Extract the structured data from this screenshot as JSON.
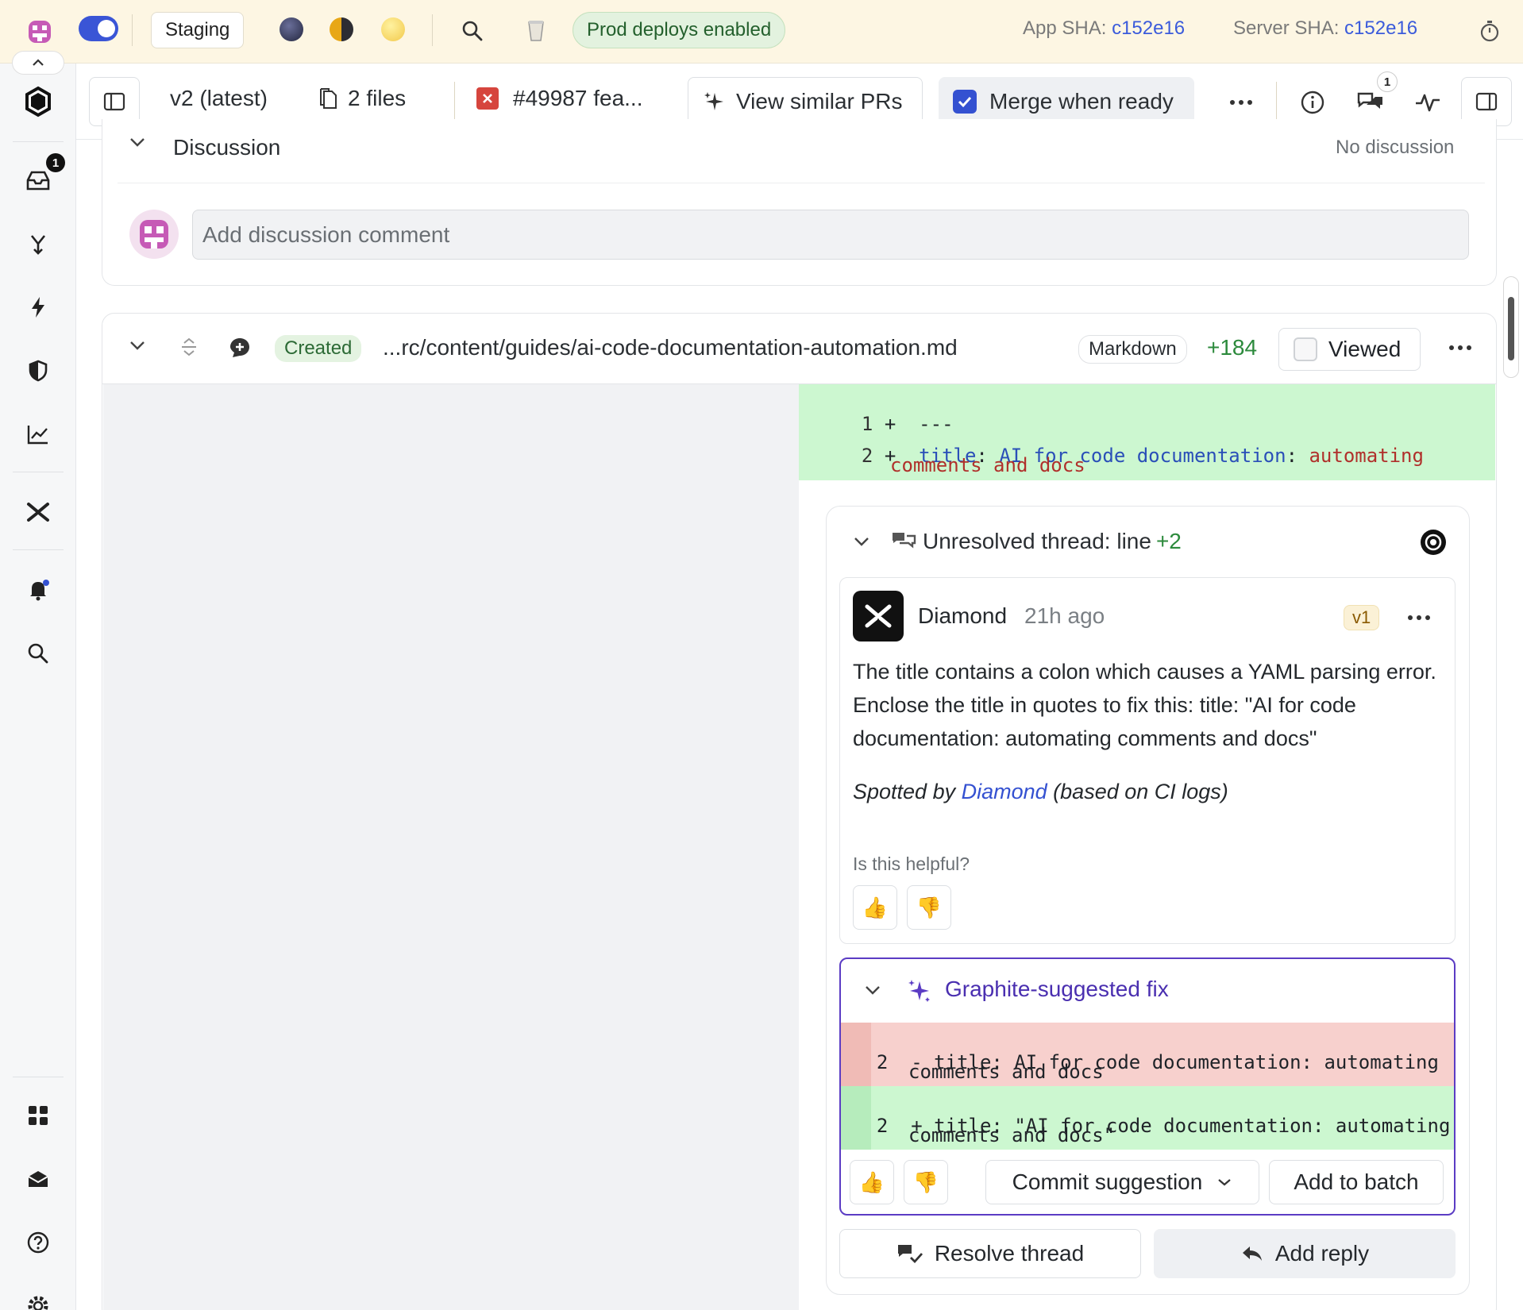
{
  "topbar": {
    "env_label": "Staging",
    "prod_status": "Prod deploys enabled",
    "app_sha_label": "App SHA:",
    "app_sha_value": "c152e16",
    "server_sha_label": "Server SHA:",
    "server_sha_value": "c152e16"
  },
  "sidebar": {
    "inbox_badge": "1"
  },
  "pr_toolbar": {
    "version": "v2 (latest)",
    "files": "2 files",
    "pr_title": "#49987 fea...",
    "similar_prs": "View similar PRs",
    "merge_when_ready": "Merge when ready",
    "comments_badge": "1"
  },
  "discussion": {
    "title": "Discussion",
    "status": "No discussion",
    "comment_placeholder": "Add discussion comment"
  },
  "file": {
    "status": "Created",
    "path": "...rc/content/guides/ai-code-documentation-automation.md",
    "language": "Markdown",
    "additions": "+184",
    "viewed_label": "Viewed",
    "lines": [
      {
        "num": "1",
        "sign": "+",
        "text": "---"
      },
      {
        "num": "2",
        "sign": "+",
        "key": "title",
        "colon": ":",
        "key_rest": " AI for code documentation",
        "colon2": ":",
        "value": " automating",
        "value_cont": "comments and docs"
      }
    ]
  },
  "thread": {
    "title_prefix": "Unresolved thread: line ",
    "line_ref": "+2",
    "author": "Diamond",
    "time": "21h ago",
    "version": "v1",
    "body": "The title contains a colon which causes a YAML parsing error. Enclose the title in quotes to fix this: title: \"AI for code documentation: automating comments and docs\"",
    "spotted_prefix": "Spotted by ",
    "spotted_link": "Diamond",
    "spotted_suffix": " (based on CI logs)",
    "helpful_prompt": "Is this helpful?",
    "resolve_label": "Resolve thread",
    "reply_label": "Add reply"
  },
  "suggested_fix": {
    "title": "Graphite-suggested fix",
    "removed": {
      "num": "2",
      "sign": "-",
      "line1": "title: AI for code documentation: automating",
      "line2": "comments and docs"
    },
    "added": {
      "num": "2",
      "sign": "+",
      "line1": "title: \"AI for code documentation: automating",
      "line2": "comments and docs\""
    },
    "commit_label": "Commit suggestion",
    "batch_label": "Add to batch"
  },
  "colors": {
    "accent": "#3451d1",
    "added_bg": "#ccf7d0",
    "removed_bg": "#f7d0cd",
    "fix_border": "#5b3cc4"
  }
}
